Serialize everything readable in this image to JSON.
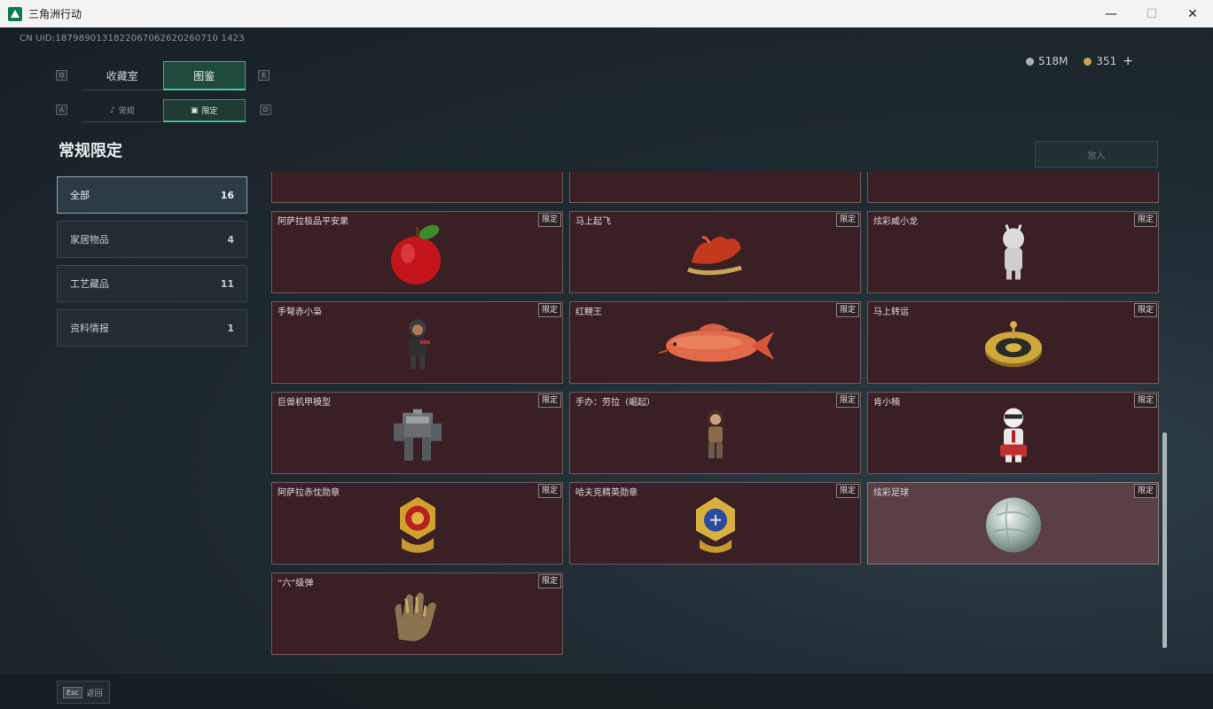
{
  "window": {
    "title": "三角洲行动",
    "minimize": "—",
    "maximize": "☐",
    "close": "✕"
  },
  "uid": "CN UID:1879890131822067062620260710 1423",
  "currency": {
    "silver": "518M",
    "gold": "351",
    "add": "+"
  },
  "keys": {
    "q": "Q",
    "e": "E",
    "a": "A",
    "d": "D"
  },
  "main_tabs": [
    {
      "label": "收藏室",
      "active": false
    },
    {
      "label": "图鉴",
      "active": true
    }
  ],
  "sub_tabs": [
    {
      "label": "常规",
      "icon": "♪",
      "active": false
    },
    {
      "label": "限定",
      "icon": "▣",
      "active": true
    }
  ],
  "section_title": "常规限定",
  "categories": [
    {
      "label": "全部",
      "count": "16",
      "active": true
    },
    {
      "label": "家居物品",
      "count": "4"
    },
    {
      "label": "工艺藏品",
      "count": "11"
    },
    {
      "label": "资料情报",
      "count": "1"
    }
  ],
  "put_button": "放入",
  "tag_label": "限定",
  "cards": [
    {
      "name": "",
      "tag": "",
      "art": "dark-item-icon"
    },
    {
      "name": "",
      "tag": "",
      "art": "shield-emblem-icon"
    },
    {
      "name": "",
      "tag": "",
      "art": "red-ornament-icon"
    },
    {
      "name": "阿萨拉极品平安果",
      "tag": "限定",
      "art": "red-apple-icon"
    },
    {
      "name": "马上起飞",
      "tag": "限定",
      "art": "red-horse-icon"
    },
    {
      "name": "炫彩威小龙",
      "tag": "限定",
      "art": "white-figure-icon"
    },
    {
      "name": "手弩赤小枭",
      "tag": "限定",
      "art": "hooded-figure-icon"
    },
    {
      "name": "红鲤王",
      "tag": "限定",
      "art": "red-carp-icon"
    },
    {
      "name": "马上转运",
      "tag": "限定",
      "art": "gold-wheel-icon"
    },
    {
      "name": "巨兽机甲模型",
      "tag": "限定",
      "art": "mech-model-icon"
    },
    {
      "name": "手办：劳拉（崛起）",
      "tag": "限定",
      "art": "lara-figure-icon"
    },
    {
      "name": "肯小楠",
      "tag": "限定",
      "art": "white-suit-figure-icon"
    },
    {
      "name": "阿萨拉赤忱勋章",
      "tag": "限定",
      "art": "red-medal-icon"
    },
    {
      "name": "哈夫克精英勋章",
      "tag": "限定",
      "art": "blue-medal-icon"
    },
    {
      "name": "炫彩足球",
      "tag": "限定",
      "art": "iridescent-ball-icon",
      "hover": true
    },
    {
      "name": "“六”级弹",
      "tag": "限定",
      "art": "bullet-hand-icon"
    }
  ],
  "esc": {
    "key": "Esc",
    "label": "返回"
  },
  "colors": {
    "accent_green": "#4ccc96",
    "card_bg": "#3a1f24",
    "card_border": "#6e5a5e"
  }
}
